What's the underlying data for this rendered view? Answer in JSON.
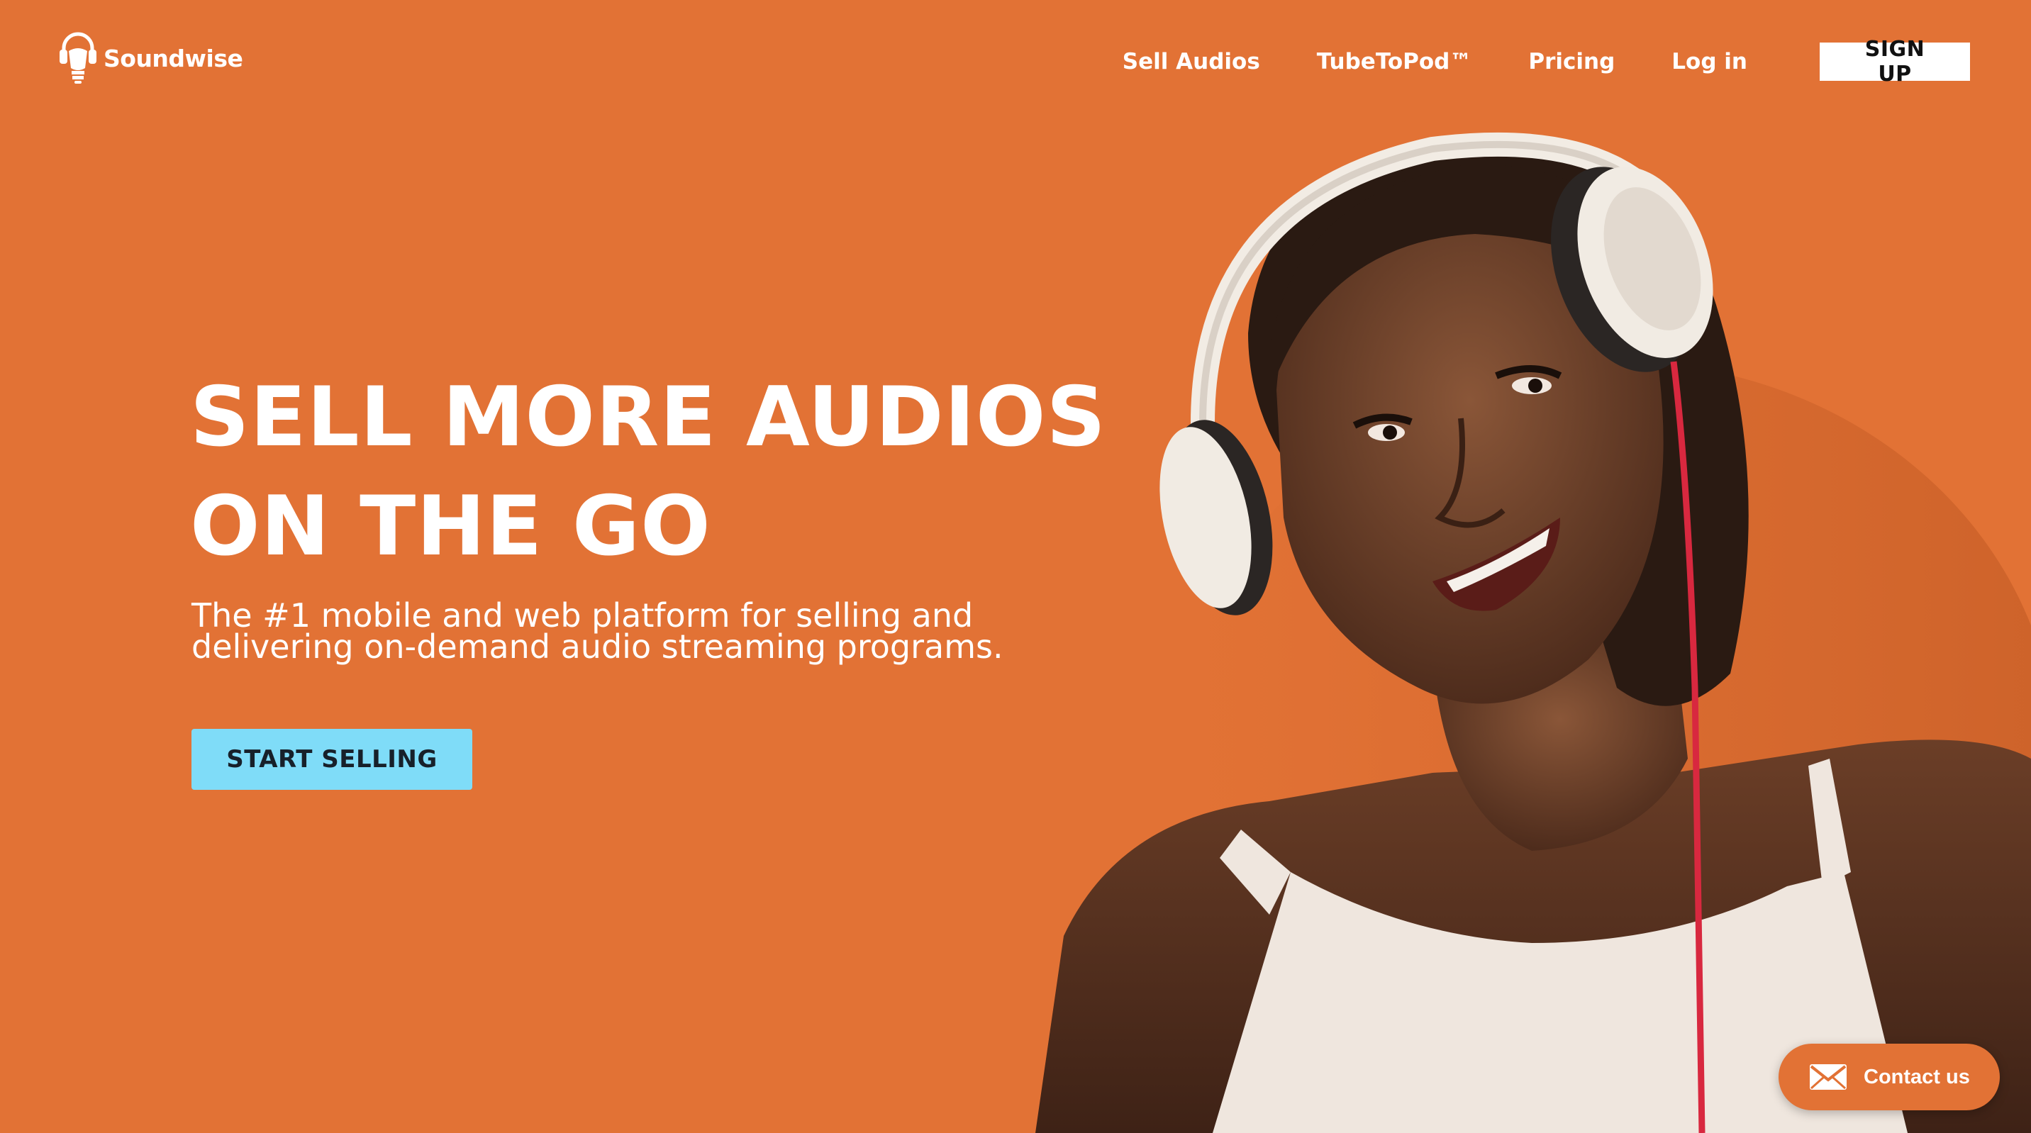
{
  "brand": {
    "name": "Soundwise",
    "icon": "headphones-bulb-icon"
  },
  "nav": {
    "items": [
      {
        "label": "Sell Audios"
      },
      {
        "label": "TubeToPod™"
      },
      {
        "label": "Pricing"
      },
      {
        "label": "Log in"
      }
    ],
    "signup_label": "SIGN UP"
  },
  "hero": {
    "headline_line1": "SELL MORE AUDIOS",
    "headline_line2": "ON THE GO",
    "subtext": "The #1 mobile and web platform for selling and delivering on-demand audio streaming programs.",
    "cta_label": "START SELLING",
    "image": "woman-with-headphones-photo"
  },
  "contact": {
    "label": "Contact us",
    "icon": "envelope-icon"
  },
  "colors": {
    "background": "#E27235",
    "cta": "#7FDCF8",
    "signup_bg": "#FFFFFF",
    "text": "#FFFFFF"
  }
}
